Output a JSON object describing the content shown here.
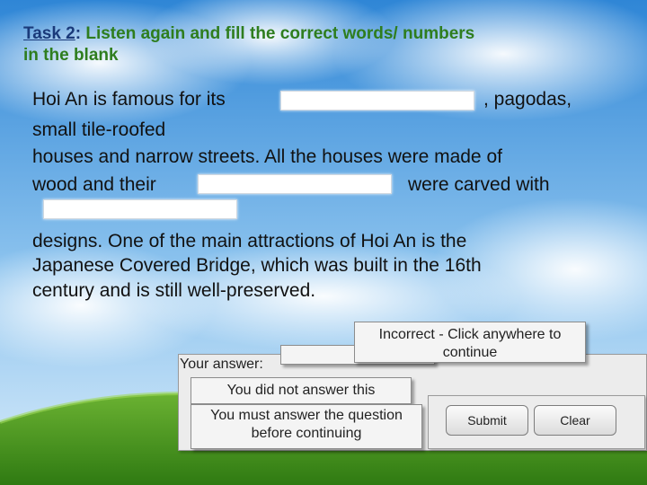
{
  "task": {
    "label": "Task 2",
    "colon": ":",
    "instruction": " Listen again and fill the correct words/ numbers",
    "instruction_line2": "in the blank"
  },
  "passage": {
    "line1_start": "Hoi An is famous for its",
    "line1_end": ", pagodas,",
    "line2": "small tile-roofed",
    "line3": "houses and narrow streets. All the houses were made of",
    "line4_start": "wood and their",
    "line4_end": "were carved with",
    "line5": "designs. One of the main attractions of Hoi An is the",
    "line6": "Japanese Covered Bridge, which was built in the 16th",
    "line7": "century and is still well-preserved."
  },
  "quiz": {
    "feedback_incorrect": "Incorrect - Click anywhere to continue",
    "your_answer_label": "Your answer:",
    "not_answered": "You did not answer this",
    "must_answer": "You must answer the question before continuing",
    "submit_label": "Submit",
    "clear_label": "Clear"
  },
  "colors": {
    "sky_top": "#2f86d6",
    "grass": "#3b8f1e",
    "heading_green": "#2e7d1e",
    "heading_blue": "#1a3a7a"
  }
}
